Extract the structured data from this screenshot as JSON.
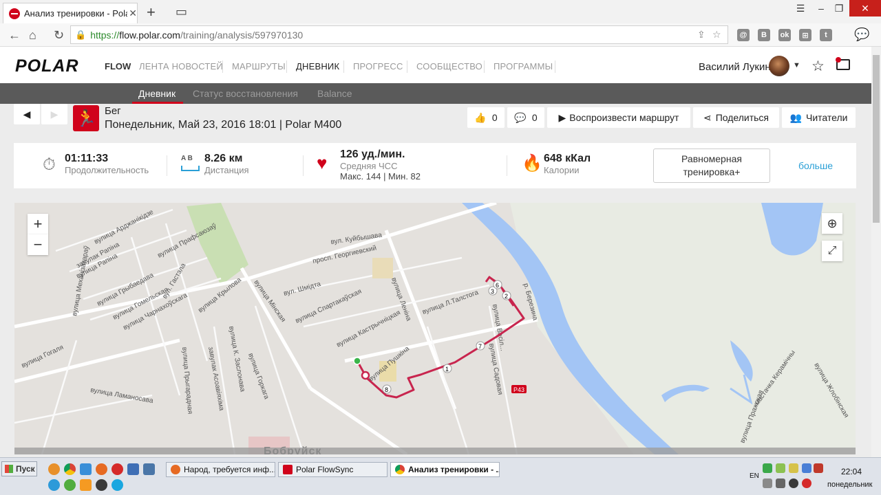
{
  "browser": {
    "tab_title": "Анализ тренировки - Polar F",
    "url_scheme": "https://",
    "url_host": "flow.polar.com",
    "url_path": "/training/analysis/597970130",
    "extensions": [
      "@",
      "B",
      "ok",
      "⊞",
      "t"
    ]
  },
  "header": {
    "logo": "POLAR",
    "flow": "FLOW",
    "nav": [
      "ЛЕНТА НОВОСТЕЙ",
      "МАРШРУТЫ",
      "ДНЕВНИК",
      "ПРОГРЕСС",
      "СООБЩЕСТВО",
      "ПРОГРАММЫ"
    ],
    "active_nav": "ДНЕВНИК",
    "user_name": "Василий Лукин"
  },
  "subnav": {
    "items": [
      "Дневник",
      "Статус восстановления",
      "Balance"
    ],
    "active": "Дневник"
  },
  "session": {
    "sport": "Бег",
    "info": "Понедельник, Май 23, 2016 18:01 | Polar M400"
  },
  "actions": {
    "likes": "0",
    "comments": "0",
    "replay": "Воспроизвести маршрут",
    "share": "Поделиться",
    "readers": "Читатели"
  },
  "stats": {
    "duration_value": "01:11:33",
    "duration_label": "Продолжительность",
    "distance_ab": "A  B",
    "distance_value": "8.26 км",
    "distance_label": "Дистанция",
    "hr_value": "126 уд./мин.",
    "hr_label": "Средняя ЧСС",
    "hr_minmax": "Макс. 144  |  Мин. 82",
    "calories_value": "648 кКал",
    "calories_label": "Калории",
    "training_type": "Равномерная тренировка+",
    "more": "больше"
  },
  "map": {
    "city": "Бобруйск",
    "route_color": "#c8254e",
    "streets": [
      "вулица Арджанікідзе",
      "вулица Рапіна",
      "завулак Рапіна",
      "вул. Куйбышава",
      "вулица Прафсаюзаў",
      "вул. Гастэла",
      "вулица Грыбаедава",
      "вулица Гомельская",
      "вулица Чарнахоўскага",
      "вулица Крылова",
      "вулица Мінская",
      "вул. Шмідта",
      "просп. Георгиевский",
      "вулица Спартакаўская",
      "вулица Леніна",
      "вулица Л.Талстога",
      "вулица Кастрычніцкая",
      "вулица Пушкіна",
      "вулица Садовая",
      "вулица Васіл...",
      "р. Березина",
      "вулица Механізатараў",
      "вулица Гогаля",
      "вулица Ламаносава",
      "вулица Горкага",
      "вулица Прыгарадная",
      "завулак Асоавіяхіма",
      "вулица К. Заслонава",
      "вулица Жлобінская",
      "мастачка Керамічны",
      "Р43",
      "вулица Пражская"
    ],
    "laps": [
      "1",
      "2",
      "3",
      "6",
      "7",
      "8"
    ],
    "zoom_in": "+",
    "zoom_out": "−"
  },
  "taskbar": {
    "start": "Пуск",
    "tasks": [
      "Народ, требуется инф...",
      "Polar FlowSync",
      "Анализ тренировки - ..."
    ],
    "lang": "EN",
    "time": "22:04",
    "day": "понедельник"
  }
}
